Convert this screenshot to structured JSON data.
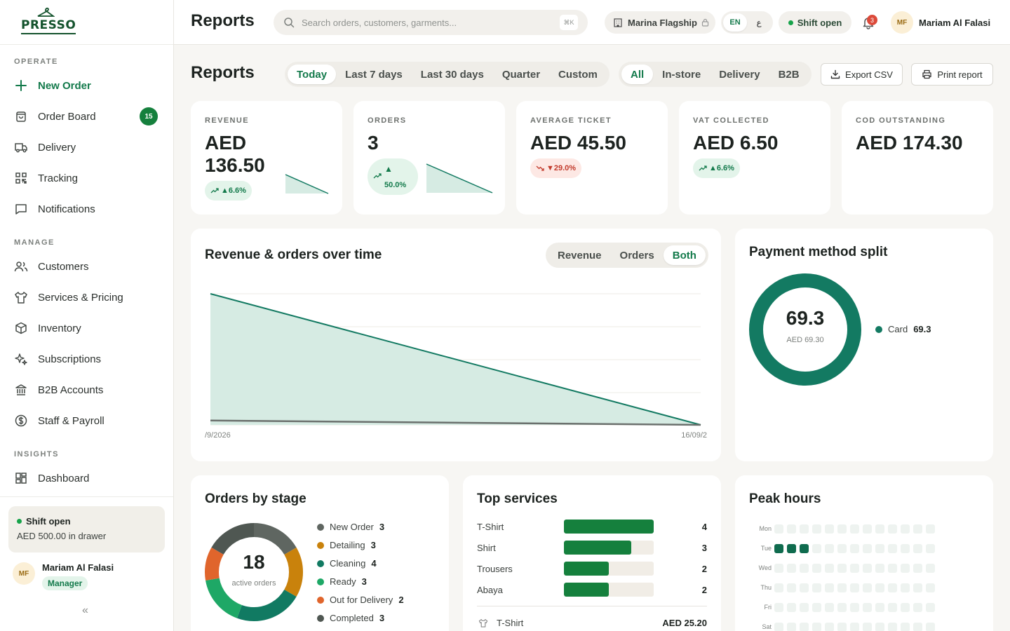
{
  "brand": {
    "name": "PRESSO",
    "color": "#14532d"
  },
  "accent": "#137a4b",
  "sidebar": {
    "sections": [
      "OPERATE",
      "MANAGE",
      "INSIGHTS"
    ],
    "items": [
      {
        "label": "New Order",
        "icon": "plus-icon"
      },
      {
        "label": "Order Board",
        "icon": "shopping-bag-icon",
        "badge": "15"
      },
      {
        "label": "Delivery",
        "icon": "truck-icon"
      },
      {
        "label": "Tracking",
        "icon": "qr-code-icon"
      },
      {
        "label": "Notifications",
        "icon": "message-square-icon"
      },
      {
        "label": "Customers",
        "icon": "users-icon"
      },
      {
        "label": "Services & Pricing",
        "icon": "shirt-icon"
      },
      {
        "label": "Inventory",
        "icon": "package-icon"
      },
      {
        "label": "Subscriptions",
        "icon": "sparkles-icon"
      },
      {
        "label": "B2B Accounts",
        "icon": "bank-icon"
      },
      {
        "label": "Staff & Payroll",
        "icon": "dollar-circle-icon"
      },
      {
        "label": "Dashboard",
        "icon": "dashboard-icon"
      }
    ],
    "shift": {
      "title": "Shift open",
      "detail": "AED 500.00 in drawer"
    },
    "user": {
      "initials": "MF",
      "name": "Mariam Al Falasi",
      "role": "Manager"
    },
    "collapse": "«"
  },
  "topbar": {
    "title": "Reports",
    "search_placeholder": "Search orders, customers, garments...",
    "shortcut": "⌘K",
    "location": "Marina Flagship",
    "lang": [
      "EN",
      "ع"
    ],
    "shift": "Shift open",
    "notifications": "3",
    "user": {
      "initials": "MF",
      "name": "Mariam Al Falasi"
    }
  },
  "main": {
    "title": "Reports",
    "ranges": [
      "Today",
      "Last 7 days",
      "Last 30 days",
      "Quarter",
      "Custom"
    ],
    "active_range": "Today",
    "channels": [
      "All",
      "In-store",
      "Delivery",
      "B2B"
    ],
    "active_channel": "All",
    "export_label": "Export CSV",
    "print_label": "Print report"
  },
  "kpis": [
    {
      "label": "REVENUE",
      "value_line1": "AED",
      "value_line2": "136.50",
      "change": "▲6.6%",
      "trend": "up"
    },
    {
      "label": "ORDERS",
      "value": "3",
      "change_arrow": "▲",
      "change": "50.0%",
      "trend": "up"
    },
    {
      "label": "AVERAGE TICKET",
      "value": "AED 45.50",
      "change": "▼29.0%",
      "trend": "down"
    },
    {
      "label": "VAT COLLECTED",
      "value": "AED 6.50",
      "change": "▲6.6%",
      "trend": "up"
    },
    {
      "label": "COD OUTSTANDING",
      "value": "AED 174.30"
    }
  ],
  "revenue_chart": {
    "title": "Revenue & orders over time",
    "toggles": [
      "Revenue",
      "Orders",
      "Both"
    ],
    "active_toggle": "Both",
    "x_start_label": "/9/2026",
    "x_end_label": "16/09/2",
    "fill_color": "#d6ebe3",
    "line_color": "#137a62"
  },
  "chart_data": [
    {
      "type": "area",
      "x": [
        "/9/2026",
        "16/09/2"
      ],
      "series": [
        {
          "values": [
            136.5,
            0
          ]
        },
        {
          "values": [
            3,
            0
          ]
        }
      ]
    },
    {
      "type": "pie",
      "categories": [
        "Card"
      ],
      "values": [
        69.3
      ]
    },
    {
      "type": "pie",
      "categories": [
        "New Order",
        "Detailing",
        "Cleaning",
        "Ready",
        "Out for Delivery",
        "Completed"
      ],
      "values": [
        3,
        3,
        4,
        3,
        2,
        3
      ]
    },
    {
      "type": "bar",
      "categories": [
        "T-Shirt",
        "Shirt",
        "Trousers",
        "Abaya"
      ],
      "values": [
        4,
        3,
        2,
        2
      ]
    },
    {
      "type": "heatmap",
      "categories": [
        "Mon",
        "Tue",
        "Wed",
        "Thu",
        "Fri",
        "Sat"
      ],
      "values": [
        [
          0,
          0,
          0,
          0,
          0,
          0,
          0,
          0,
          0,
          0,
          0,
          0,
          0
        ],
        [
          1,
          1,
          1,
          0,
          0,
          0,
          0,
          0,
          0,
          0,
          0,
          0,
          0
        ],
        [
          0,
          0,
          0,
          0,
          0,
          0,
          0,
          0,
          0,
          0,
          0,
          0,
          0
        ],
        [
          0,
          0,
          0,
          0,
          0,
          0,
          0,
          0,
          0,
          0,
          0,
          0,
          0
        ],
        [
          0,
          0,
          0,
          0,
          0,
          0,
          0,
          0,
          0,
          0,
          0,
          0,
          0
        ],
        [
          0,
          0,
          0,
          0,
          0,
          0,
          0,
          0,
          0,
          0,
          0,
          0,
          0
        ]
      ]
    }
  ],
  "payment_split": {
    "title": "Payment method split",
    "center_value": "69.3",
    "center_sub": "AED 69.30",
    "legend": [
      {
        "label": "Card",
        "value": "69.3",
        "color": "#137a62"
      }
    ]
  },
  "orders_by_stage": {
    "title": "Orders by stage",
    "total": "18",
    "total_label": "active orders",
    "stages": [
      {
        "label": "New Order",
        "value": "3",
        "color": "#5f6661"
      },
      {
        "label": "Detailing",
        "value": "3",
        "color": "#c9820c"
      },
      {
        "label": "Cleaning",
        "value": "4",
        "color": "#117a62"
      },
      {
        "label": "Ready",
        "value": "3",
        "color": "#1ea866"
      },
      {
        "label": "Out for Delivery",
        "value": "2",
        "color": "#e0652c"
      },
      {
        "label": "Completed",
        "value": "3",
        "color": "#4f5752"
      }
    ]
  },
  "top_services": {
    "title": "Top services",
    "rows": [
      {
        "label": "T-Shirt",
        "value": "4"
      },
      {
        "label": "Shirt",
        "value": "3"
      },
      {
        "label": "Trousers",
        "value": "2"
      },
      {
        "label": "Abaya",
        "value": "2"
      }
    ],
    "footer": {
      "label": "T-Shirt",
      "value": "AED 25.20",
      "icon": "shirt-icon"
    }
  },
  "peak_hours": {
    "title": "Peak hours",
    "days": [
      "Mon",
      "Tue",
      "Wed",
      "Thu",
      "Fri",
      "Sat"
    ]
  }
}
